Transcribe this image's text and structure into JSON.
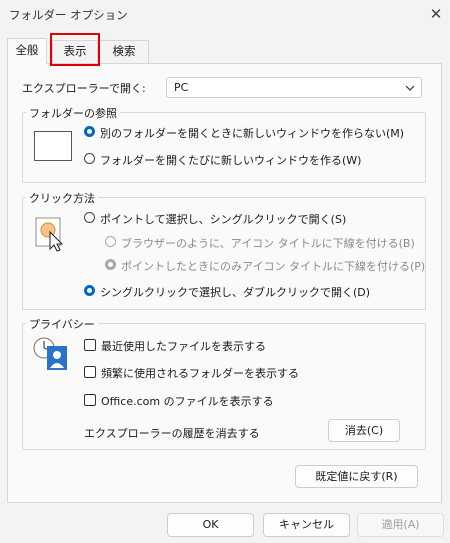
{
  "window": {
    "title": "フォルダー オプション",
    "close_icon": "close-icon"
  },
  "tabs": [
    {
      "label": "全般",
      "active": true
    },
    {
      "label": "表示",
      "active": false,
      "highlighted": true
    },
    {
      "label": "検索",
      "active": false
    }
  ],
  "open_explorer": {
    "label": "エクスプローラーで開く:",
    "value": "PC"
  },
  "folder_browsing": {
    "legend": "フォルダーの参照",
    "options": [
      {
        "label": "別のフォルダーを開くときに新しいウィンドウを作らない(M)",
        "checked": true
      },
      {
        "label": "フォルダーを開くたびに新しいウィンドウを作る(W)",
        "checked": false
      }
    ]
  },
  "click_method": {
    "legend": "クリック方法",
    "options": [
      {
        "label": "ポイントして選択し、シングルクリックで開く(S)",
        "checked": false,
        "disabled": false
      },
      {
        "label": "ブラウザーのように、アイコン タイトルに下線を付ける(B)",
        "checked": false,
        "disabled": true
      },
      {
        "label": "ポイントしたときにのみアイコン タイトルに下線を付ける(P)",
        "checked": true,
        "disabled": true
      },
      {
        "label": "シングルクリックで選択し、ダブルクリックで開く(D)",
        "checked": true,
        "disabled": false
      }
    ]
  },
  "privacy": {
    "legend": "プライバシー",
    "checkboxes": [
      {
        "label": "最近使用したファイルを表示する",
        "checked": false
      },
      {
        "label": "頻繁に使用されるフォルダーを表示する",
        "checked": false
      },
      {
        "label": "Office.com のファイルを表示する",
        "checked": false
      }
    ],
    "history_label": "エクスプローラーの履歴を消去する",
    "clear_button": "消去(C)"
  },
  "restore_button": "既定値に戻す(R)",
  "footer": {
    "ok": "OK",
    "cancel": "キャンセル",
    "apply": "適用(A)"
  },
  "colors": {
    "accent": "#0067c0",
    "highlight": "#e00000"
  }
}
